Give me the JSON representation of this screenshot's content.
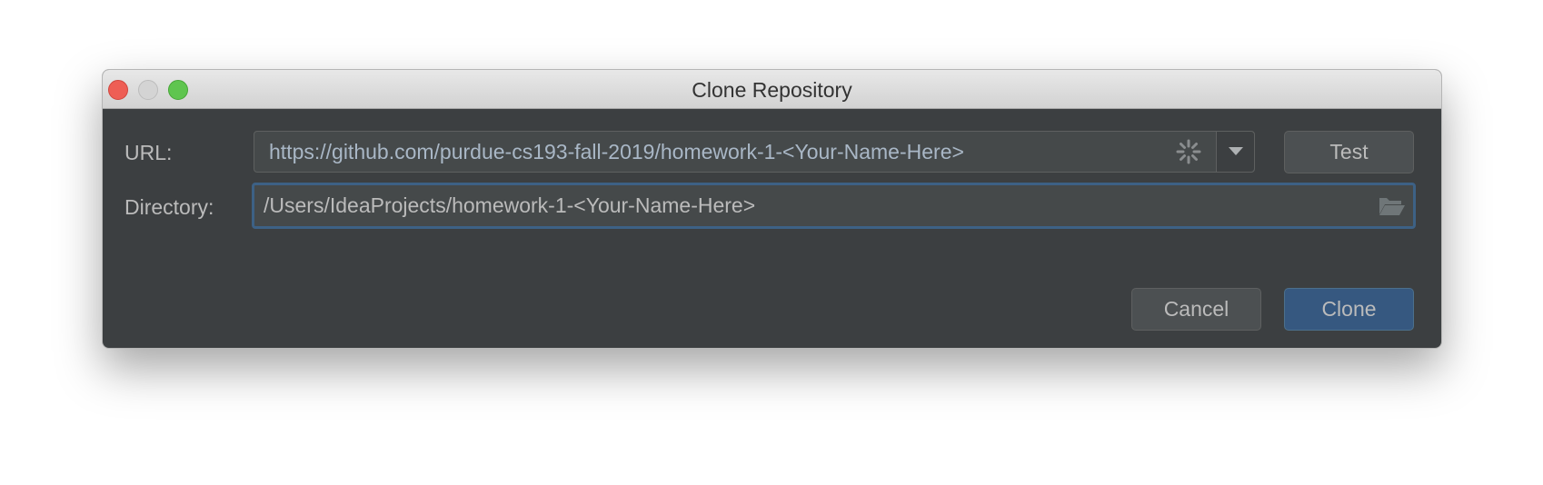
{
  "window": {
    "title": "Clone Repository"
  },
  "url": {
    "label": "URL:",
    "value": "https://github.com/purdue-cs193-fall-2019/homework-1-<Your-Name-Here>"
  },
  "directory": {
    "label": "Directory:",
    "value": "/Users/IdeaProjects/homework-1-<Your-Name-Here>"
  },
  "buttons": {
    "test": "Test",
    "cancel": "Cancel",
    "clone": "Clone"
  },
  "colors": {
    "accent": "#365880",
    "focus_border": "#3d6185",
    "background": "#3c3f41"
  }
}
